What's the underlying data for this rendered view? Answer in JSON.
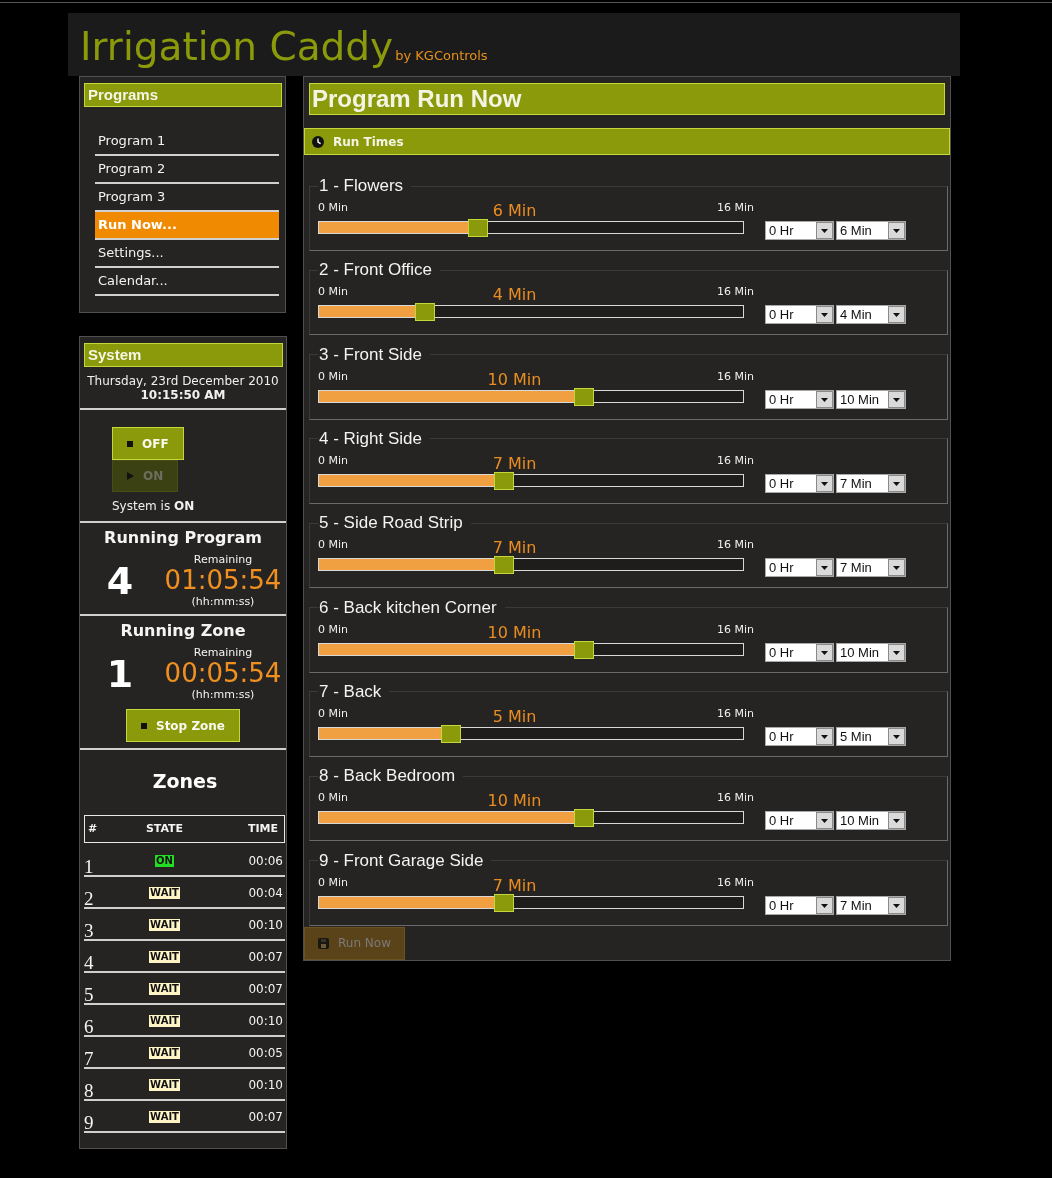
{
  "header": {
    "title": "Irrigation Caddy",
    "byline": "by KGControls"
  },
  "programs": {
    "title": "Programs",
    "items": [
      {
        "label": "Program 1",
        "selected": false
      },
      {
        "label": "Program 2",
        "selected": false
      },
      {
        "label": "Program 3",
        "selected": false
      },
      {
        "label": "Run Now...",
        "selected": true
      },
      {
        "label": "Settings...",
        "selected": false
      },
      {
        "label": "Calendar...",
        "selected": false
      }
    ]
  },
  "system": {
    "title": "System",
    "date": "Thursday, 23rd December 2010",
    "time": "10:15:50 AM",
    "buttons": [
      {
        "kind": "stop",
        "label": "OFF",
        "disabled": false
      },
      {
        "kind": "play",
        "label": "ON",
        "disabled": true
      }
    ],
    "status": "System is **ON**"
  },
  "running_program": {
    "title": "Running Program",
    "number": "4",
    "remaining_label": "Remaining",
    "remaining": "01:05:54",
    "format": "(hh:mm:ss)"
  },
  "running_zone": {
    "title": "Running Zone",
    "number": "1",
    "remaining_label": "Remaining",
    "remaining": "00:05:54",
    "format": "(hh:mm:ss)",
    "button": {
      "kind": "stop",
      "label": "Stop Zone",
      "disabled": false
    }
  },
  "zones": {
    "title": "Zones",
    "columns": [
      "#",
      "STATE",
      "TIME"
    ],
    "rows": [
      {
        "number": "1",
        "state": "ON",
        "color": "#22dd22",
        "time": "00:06"
      },
      {
        "number": "2",
        "state": "WAIT",
        "color": "#fff4c4",
        "time": "00:04"
      },
      {
        "number": "3",
        "state": "WAIT",
        "color": "#fff4c4",
        "time": "00:10"
      },
      {
        "number": "4",
        "state": "WAIT",
        "color": "#fff4c4",
        "time": "00:07"
      },
      {
        "number": "5",
        "state": "WAIT",
        "color": "#fff4c4",
        "time": "00:07"
      },
      {
        "number": "6",
        "state": "WAIT",
        "color": "#fff4c4",
        "time": "00:10"
      },
      {
        "number": "7",
        "state": "WAIT",
        "color": "#fff4c4",
        "time": "00:05"
      },
      {
        "number": "8",
        "state": "WAIT",
        "color": "#fff4c4",
        "time": "00:10"
      },
      {
        "number": "9",
        "state": "WAIT",
        "color": "#fff4c4",
        "time": "00:07"
      }
    ]
  },
  "main": {
    "title": "Program Run Now",
    "section": "Run Times",
    "zones": [
      {
        "name": "1 - Flowers",
        "min_label": "0 Min",
        "max_label": "16 Min",
        "value": "6 Min",
        "level": 0.375,
        "hours": "0 Hr",
        "minutes": "6 Min"
      },
      {
        "name": "2 - Front Office",
        "min_label": "0 Min",
        "max_label": "16 Min",
        "value": "4 Min",
        "level": 0.25,
        "hours": "0 Hr",
        "minutes": "4 Min"
      },
      {
        "name": "3 - Front Side",
        "min_label": "0 Min",
        "max_label": "16 Min",
        "value": "10 Min",
        "level": 0.625,
        "hours": "0 Hr",
        "minutes": "10 Min"
      },
      {
        "name": "4 - Right Side",
        "min_label": "0 Min",
        "max_label": "16 Min",
        "value": "7 Min",
        "level": 0.4375,
        "hours": "0 Hr",
        "minutes": "7 Min"
      },
      {
        "name": "5 - Side Road Strip",
        "min_label": "0 Min",
        "max_label": "16 Min",
        "value": "7 Min",
        "level": 0.4375,
        "hours": "0 Hr",
        "minutes": "7 Min"
      },
      {
        "name": "6 - Back kitchen Corner",
        "min_label": "0 Min",
        "max_label": "16 Min",
        "value": "10 Min",
        "level": 0.625,
        "hours": "0 Hr",
        "minutes": "10 Min"
      },
      {
        "name": "7 - Back",
        "min_label": "0 Min",
        "max_label": "16 Min",
        "value": "5 Min",
        "level": 0.3125,
        "hours": "0 Hr",
        "minutes": "5 Min"
      },
      {
        "name": "8 - Back Bedroom",
        "min_label": "0 Min",
        "max_label": "16 Min",
        "value": "10 Min",
        "level": 0.625,
        "hours": "0 Hr",
        "minutes": "10 Min"
      },
      {
        "name": "9 - Front Garage Side",
        "min_label": "0 Min",
        "max_label": "16 Min",
        "value": "7 Min",
        "level": 0.4375,
        "hours": "0 Hr",
        "minutes": "7 Min"
      }
    ],
    "run_button": {
      "kind": "save",
      "label": "Run Now",
      "disabled": true
    }
  }
}
